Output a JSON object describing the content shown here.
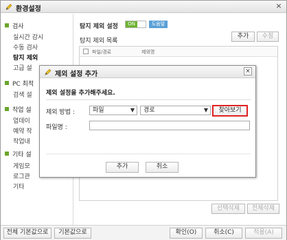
{
  "window": {
    "title": "환경설정",
    "close": "×"
  },
  "sidebar": {
    "categories": [
      {
        "label": "검사",
        "items": [
          "실시간 감시",
          "수동 검사",
          "탐지 제외",
          "고급 설"
        ]
      },
      {
        "label": "PC 최적",
        "items": [
          "검색 설"
        ]
      },
      {
        "label": "작업 설",
        "items": [
          "업데이",
          "예약 작",
          "작업내"
        ]
      },
      {
        "label": "기타 설",
        "items": [
          "게임모",
          "로그관",
          "기타"
        ]
      }
    ]
  },
  "main": {
    "title": "탐지 제외 설정",
    "toggle_on": "ON",
    "help": "도움말",
    "list_title": "탐지 제외 목록",
    "add_button": "추가",
    "edit_button": "수정",
    "columns": [
      "파일/경로",
      "제외명"
    ],
    "delete_selected": "선택삭제",
    "delete_all": "전체삭제"
  },
  "bottom": {
    "reset_all": "전체 기본값으로",
    "reset": "기본값으로",
    "ok": "확인(O)",
    "cancel": "취소(C)",
    "apply": "적용(A)"
  },
  "dialog": {
    "title": "제외 설정 추가",
    "close": "×",
    "heading": "제외 설정을 추가해주세요.",
    "method_label": "제외 방법 :",
    "method_value": "파일",
    "path_value": "경로",
    "browse_button": "찾아보기",
    "filename_label": "파일명 :",
    "filename_value": "",
    "add_button": "추가",
    "cancel_button": "취소"
  },
  "colors": {
    "accent_green": "#6fb331",
    "help_blue": "#5aa0d6",
    "highlight_red": "#e02020"
  }
}
